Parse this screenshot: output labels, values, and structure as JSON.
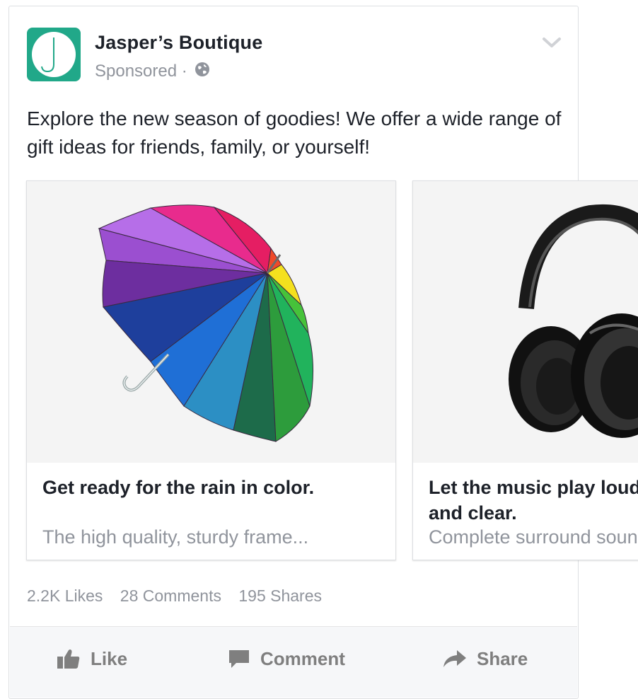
{
  "post": {
    "page_name": "Jasper’s Boutique",
    "sponsored_label": "Sponsored ·",
    "message": "Explore the new season of goodies! We offer a wide range of gift ideas for friends, family, or yourself!",
    "icons": {
      "avatar": "boutique-logo",
      "globe": "globe-icon",
      "menu": "chevron-down-icon"
    }
  },
  "carousel": {
    "cards": [
      {
        "image": "rainbow-umbrella",
        "headline": "Get ready for the rain in color.",
        "description": "The high quality, sturdy frame..."
      },
      {
        "image": "black-headphones",
        "headline": "Let the music play loud and clear.",
        "description": "Complete surround sound"
      }
    ]
  },
  "stats": {
    "likes": "2.2K Likes",
    "comments": "28 Comments",
    "shares": "195 Shares"
  },
  "actions": {
    "like": "Like",
    "comment": "Comment",
    "share": "Share"
  },
  "colors": {
    "brand_green": "#21a889",
    "text_primary": "#1d2129",
    "text_secondary": "#90949c",
    "action_gray": "#7f7f7f"
  }
}
